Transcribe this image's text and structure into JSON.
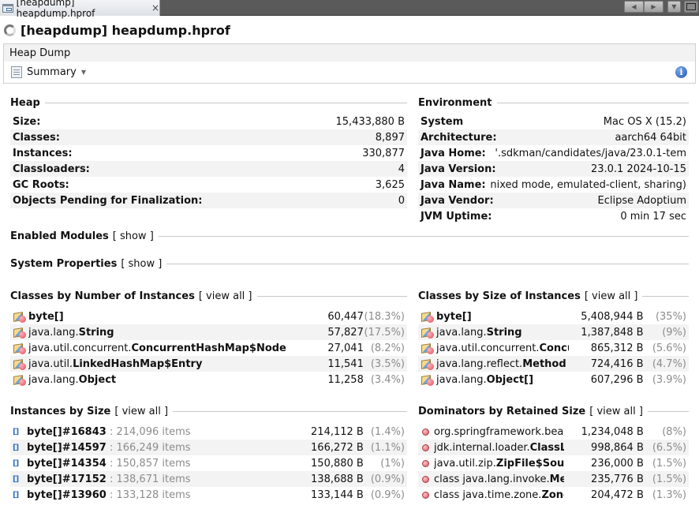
{
  "tab": {
    "label": "[heapdump] heapdump.hprof",
    "close": "×"
  },
  "title": "[heapdump] heapdump.hprof",
  "header": {
    "section": "Heap Dump",
    "view_selector": "Summary"
  },
  "heap": {
    "title": "Heap",
    "rows": [
      {
        "label": "Size:",
        "value": "15,433,880 B"
      },
      {
        "label": "Classes:",
        "value": "8,897"
      },
      {
        "label": "Instances:",
        "value": "330,877"
      },
      {
        "label": "Classloaders:",
        "value": "4"
      },
      {
        "label": "GC Roots:",
        "value": "3,625"
      },
      {
        "label": "Objects Pending for Finalization:",
        "value": "0"
      }
    ]
  },
  "environment": {
    "title": "Environment",
    "rows": [
      {
        "label": "System",
        "value": "Mac OS X (15.2)"
      },
      {
        "label": "Architecture:",
        "value": "aarch64 64bit"
      },
      {
        "label": "Java Home:",
        "value": "'.sdkman/candidates/java/23.0.1-tem"
      },
      {
        "label": "Java Version:",
        "value": "23.0.1 2024-10-15"
      },
      {
        "label": "Java Name:",
        "value": "nixed mode, emulated-client, sharing)"
      },
      {
        "label": "Java Vendor:",
        "value": "Eclipse Adoptium"
      },
      {
        "label": "JVM Uptime:",
        "value": "0 min 17 sec"
      }
    ]
  },
  "enabled_modules": {
    "title": "Enabled Modules",
    "link": "[ show ]"
  },
  "system_properties": {
    "title": "System Properties",
    "link": "[ show ]"
  },
  "classes_by_number": {
    "title": "Classes by Number of Instances",
    "link": "[ view all ]",
    "rows": [
      {
        "pkg": "",
        "cls": "byte[]",
        "count": "60,447",
        "pct": "(18.3%)"
      },
      {
        "pkg": "java.lang.",
        "cls": "String",
        "count": "57,827",
        "pct": "(17.5%)"
      },
      {
        "pkg": "java.util.concurrent.",
        "cls": "ConcurrentHashMap$Node",
        "count": "27,041",
        "pct": "(8.2%)"
      },
      {
        "pkg": "java.util.",
        "cls": "LinkedHashMap$Entry",
        "count": "11,541",
        "pct": "(3.5%)"
      },
      {
        "pkg": "java.lang.",
        "cls": "Object",
        "count": "11,258",
        "pct": "(3.4%)"
      }
    ]
  },
  "classes_by_size": {
    "title": "Classes by Size of Instances",
    "link": "[ view all ]",
    "rows": [
      {
        "pkg": "",
        "cls": "byte[]",
        "size": "5,408,944 B",
        "pct": "(35%)"
      },
      {
        "pkg": "java.lang.",
        "cls": "String",
        "size": "1,387,848 B",
        "pct": "(9%)"
      },
      {
        "pkg": "java.util.concurrent.",
        "cls": "Concu",
        "size": "865,312 B",
        "pct": "(5.6%)"
      },
      {
        "pkg": "java.lang.reflect.",
        "cls": "Method",
        "size": "724,416 B",
        "pct": "(4.7%)"
      },
      {
        "pkg": "java.lang.",
        "cls": "Object[]",
        "size": "607,296 B",
        "pct": "(3.9%)"
      }
    ]
  },
  "instances_by_size": {
    "title": "Instances by Size",
    "link": "[ view all ]",
    "rows": [
      {
        "name": "byte[]#16843",
        "items": " : 214,096 items",
        "size": "214,112 B",
        "pct": "(1.4%)"
      },
      {
        "name": "byte[]#14597",
        "items": " : 166,249 items",
        "size": "166,272 B",
        "pct": "(1.1%)"
      },
      {
        "name": "byte[]#14354",
        "items": " : 150,857 items",
        "size": "150,880 B",
        "pct": "(1%)"
      },
      {
        "name": "byte[]#17152",
        "items": " : 138,671 items",
        "size": "138,688 B",
        "pct": "(0.9%)"
      },
      {
        "name": "byte[]#13960",
        "items": " : 133,128 items",
        "size": "133,144 B",
        "pct": "(0.9%)"
      }
    ]
  },
  "dominators": {
    "title": "Dominators by Retained Size",
    "link": "[ view all ]",
    "rows": [
      {
        "pkg": "org.springframework.beans",
        "cls": "",
        "size": "1,234,048 B",
        "pct": "(8%)"
      },
      {
        "pkg": "jdk.internal.loader.",
        "cls": "ClassLoa",
        "size": "998,864 B",
        "pct": "(6.5%)"
      },
      {
        "pkg": "java.util.zip.",
        "cls": "ZipFile$Source",
        "size": "236,000 B",
        "pct": "(1.5%)"
      },
      {
        "pkg": "class java.lang.invoke.",
        "cls": "Meth",
        "size": "235,776 B",
        "pct": "(1.5%)"
      },
      {
        "pkg": "class java.time.zone.",
        "cls": "ZoneR",
        "size": "204,472 B",
        "pct": "(1.3%)"
      }
    ]
  }
}
